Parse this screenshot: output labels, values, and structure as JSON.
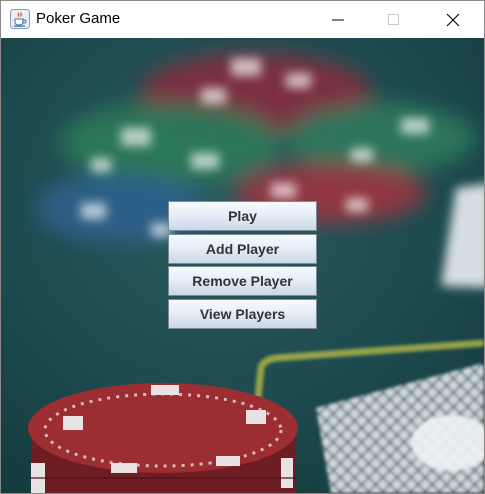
{
  "window": {
    "title": "Poker Game",
    "icon": "java-cup-icon",
    "controls": [
      "minimize-icon",
      "maximize-icon",
      "close-icon"
    ]
  },
  "menu": {
    "play_label": "Play",
    "add_player_label": "Add Player",
    "remove_player_label": "Remove Player",
    "view_players_label": "View Players"
  },
  "colors": {
    "table_felt": "#1f4f52",
    "chip_red": "#8c2a2f",
    "chip_green": "#2e7a5a",
    "chip_blue": "#2f5f8a",
    "button_border": "#7a8a99"
  }
}
